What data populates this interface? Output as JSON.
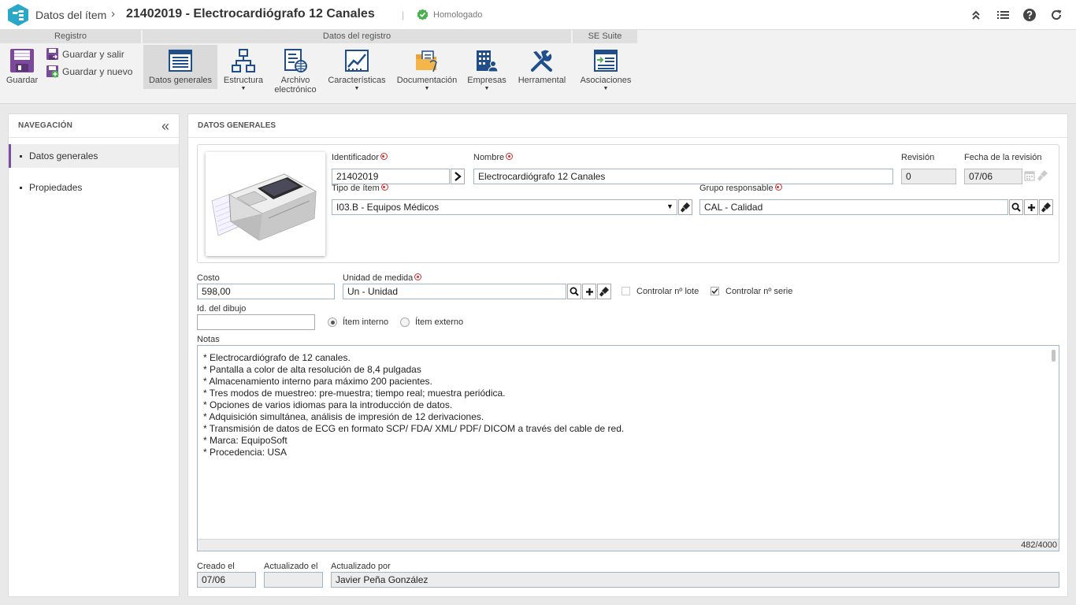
{
  "header": {
    "breadcrumb": "Datos del ítem",
    "separator": "›",
    "title": "21402019 - Electrocardiógrafo 12 Canales",
    "pipe": "|",
    "status": "Homologado",
    "status_color": "#4caf50",
    "actions": [
      "collapse-icon",
      "list-icon",
      "help-icon",
      "refresh-icon"
    ]
  },
  "ribbon": {
    "groups": {
      "registro": "Registro",
      "datos_registro": "Datos del registro",
      "se_suite": "SE Suite"
    },
    "guardar": "Guardar",
    "guardar_salir": "Guardar y salir",
    "guardar_nuevo": "Guardar y nuevo",
    "datos_generales": "Datos generales",
    "estructura": "Estructura",
    "archivo_1": "Archivo",
    "archivo_2": "electrónico",
    "caracteristicas": "Características",
    "documentacion": "Documentación",
    "empresas": "Empresas",
    "herramental": "Herramental",
    "asociaciones": "Asociaciones",
    "caret": "▼"
  },
  "nav": {
    "title": "NAVEGACIÓN",
    "collapse": "«",
    "items": [
      {
        "label": "Datos generales"
      },
      {
        "label": "Propiedades"
      }
    ]
  },
  "main": {
    "title": "DATOS GENERALES"
  },
  "form": {
    "identificador_label": "Identificador",
    "identificador": "21402019",
    "nombre_label": "Nombre",
    "nombre": "Electrocardiógrafo 12 Canales",
    "revision_label": "Revisión",
    "revision": "0",
    "fecha_revision_label": "Fecha de la revisión",
    "fecha_revision": "07/06",
    "tipo_label": "Tipo de ítem",
    "tipo": "I03.B - Equipos Médicos",
    "grupo_label": "Grupo responsable",
    "grupo": "CAL - Calidad",
    "costo_label": "Costo",
    "costo": "598,00",
    "unidad_label": "Unidad de medida",
    "unidad": "Un - Unidad",
    "controlar_lote": "Controlar nº lote",
    "controlar_serie": "Controlar nº serie",
    "dibujo_label": "Id. del dibujo",
    "dibujo": "",
    "item_interno": "Ítem interno",
    "item_externo": "Ítem externo",
    "notas_label": "Notas",
    "notas": [
      "* Electrocardiógrafo de 12 canales.",
      "* Pantalla a color de alta resolución de 8,4 pulgadas",
      "* Almacenamiento interno para máximo 200 pacientes.",
      "* Tres modos de muestreo: pre-muestra; tiempo real; muestra periódica.",
      "* Opciones de varios idiomas para la introducción de datos.",
      "* Adquisición simultánea, análisis de impresión de 12 derivaciones.",
      "* Transmisión de datos de ECG en formato SCP/ FDA/ XML/ PDF/ DICOM a través del cable de red.",
      "* Marca: EquipoSoft",
      "* Procedencia: USA"
    ],
    "notas_counter": "482/4000",
    "creado_label": "Creado el",
    "creado": "07/06",
    "actualizado_label": "Actualizado el",
    "actualizado": "",
    "actualizado_por_label": "Actualizado por",
    "actualizado_por": "Javier Peña González"
  },
  "colors": {
    "accent": "#7a4ea1",
    "logo": "#29a8c7",
    "required": "#d32f2f"
  }
}
